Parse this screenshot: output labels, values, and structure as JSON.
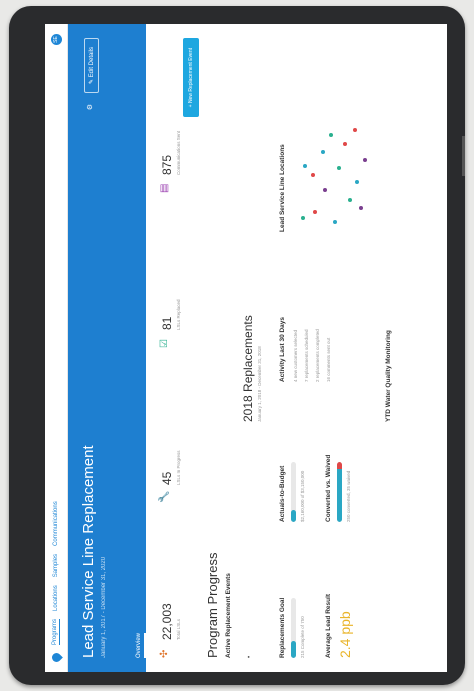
{
  "nav": {
    "items": [
      "Programs",
      "Locations",
      "Samples",
      "Communications"
    ],
    "user_initials": "SE"
  },
  "hero": {
    "title": "Lead Service Line Replacement",
    "dates": "January 1, 2017 - December 31, 2020",
    "tab": "Overview",
    "edit_label": "Edit Details"
  },
  "stats": [
    {
      "value": "22,003",
      "label": "Total LSLs",
      "icon": "network-icon"
    },
    {
      "value": "45",
      "label": "LSLs In Progress",
      "icon": "wrench-icon"
    },
    {
      "value": "81",
      "label": "LSLs Replaced",
      "icon": "checkbox-icon"
    },
    {
      "value": "875",
      "label": "Communications Sent",
      "icon": "document-icon"
    }
  ],
  "new_event_label": "New Replacement Event",
  "program": {
    "title": "Program Progress",
    "active_label": "Active Replacement Events",
    "section_title": "2018 Replacements",
    "section_dates": "January 1, 2018 - December 31, 2018"
  },
  "metrics": {
    "goal_title": "Replacements Goal",
    "goal_text": "215 Complete of 750",
    "goal_progress": 0.29,
    "budget_title": "Actuals-to-Budget",
    "budget_text": "$2,160,000 of $3,150,000",
    "budget_progress": 0.2,
    "activity_title": "Activity Last 30 Days",
    "activity_items": [
      "4 new customers selected",
      "7 replacements scheduled",
      "2 replacements completed",
      "16 comments sent out"
    ],
    "lead_title": "Average Lead Result",
    "lead_value": "2.4 ppb",
    "converted_title": "Converted vs. Waived",
    "converted_text": "250 converted, 35 waived",
    "converted_progress": 0.88,
    "locations_title": "Lead Service Line Locations",
    "footer": "YTD Water Quality Monitoring"
  },
  "colors": {
    "brand": "#1e7fd0",
    "accent": "#1ea7e0",
    "teal": "#2aa7c4",
    "gold": "#e9b42a",
    "red": "#e04848"
  }
}
